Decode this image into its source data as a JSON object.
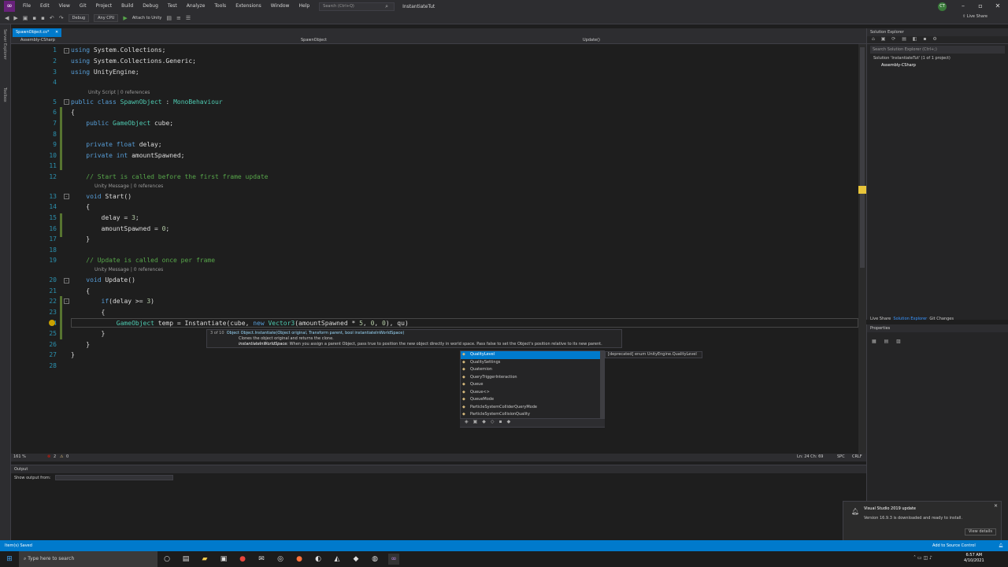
{
  "titlebar": {
    "menu": [
      "File",
      "Edit",
      "View",
      "Git",
      "Project",
      "Build",
      "Debug",
      "Test",
      "Analyze",
      "Tools",
      "Extensions",
      "Window",
      "Help"
    ],
    "search_placeholder": "Search (Ctrl+Q)",
    "project_title": "InstantiateTut",
    "user_initials": "CT",
    "live_share": "Live Share"
  },
  "toolbar": {
    "config": "Debug",
    "platform": "Any CPU",
    "attach": "Attach to Unity"
  },
  "leftstrip": {
    "labels": [
      "Server Explorer",
      "Toolbox"
    ]
  },
  "editor": {
    "tab_label": "SpawnObject.cs*",
    "nav_project": "Assembly-CSharp",
    "nav_class": "SpawnObject",
    "nav_member": "Update()",
    "line_numbers": [
      "1",
      "2",
      "3",
      "4",
      "5",
      "6",
      "7",
      "8",
      "9",
      "10",
      "11",
      "12",
      "13",
      "14",
      "15",
      "16",
      "17",
      "18",
      "19",
      "20",
      "21",
      "22",
      "23",
      "24",
      "25",
      "26",
      "27",
      "28"
    ],
    "lenses": {
      "l5": "Unity Script | 0 references",
      "l13": "Unity Message | 0 references",
      "l20": "Unity Message | 0 references"
    },
    "zoom": "161 %",
    "errors": "2",
    "warnings": "0",
    "position": "Ln: 24   Ch: 69",
    "spc": "SPC",
    "eol": "CRLF"
  },
  "tooltip": {
    "counter": "3 of 10",
    "signature": "Object Object.Instantiate(Object original, Transform parent, bool instantiateInWorldSpace)",
    "summary": "Clones the object original and returns the clone.",
    "param_name": "instantiateInWorldSpace:",
    "param_desc": "When you assign a parent Object, pass true to position the new object directly in world space. Pass false to set the Object's position relative to its new parent."
  },
  "completion": {
    "items": [
      "QualityLevel",
      "QualitySettings",
      "Quaternion",
      "QueryTriggerInteraction",
      "Queue",
      "Queue<>",
      "QueueMode",
      "ParticleSystemColliderQueryMode",
      "ParticleSystemCollisionQuality"
    ],
    "selected_index": 0,
    "detail": "[deprecated] enum UnityEngine.QualityLevel"
  },
  "output": {
    "title": "Output",
    "show_from": "Show output from:"
  },
  "solution_explorer": {
    "title": "Solution Explorer",
    "search_placeholder": "Search Solution Explorer (Ctrl+;)",
    "solution": "Solution 'InstantiateTut' (1 of 1 project)",
    "project": "Assembly-CSharp",
    "tabs": [
      "Live Share",
      "Solution Explorer",
      "Git Changes"
    ]
  },
  "properties": {
    "title": "Properties"
  },
  "statusbar": {
    "left": "Item(s) Saved",
    "right": "Add to Source Control"
  },
  "notification": {
    "title": "Visual Studio 2019 update",
    "body": "Version 16.9.3 is downloaded and ready to install.",
    "button": "View details"
  },
  "taskbar": {
    "search_placeholder": "Type here to search",
    "time": "6:57 AM",
    "date": "4/10/2021"
  },
  "colors": {
    "accent": "#007acc",
    "keyword": "#569cd6",
    "type": "#4ec9b0",
    "comment": "#57a64a"
  }
}
